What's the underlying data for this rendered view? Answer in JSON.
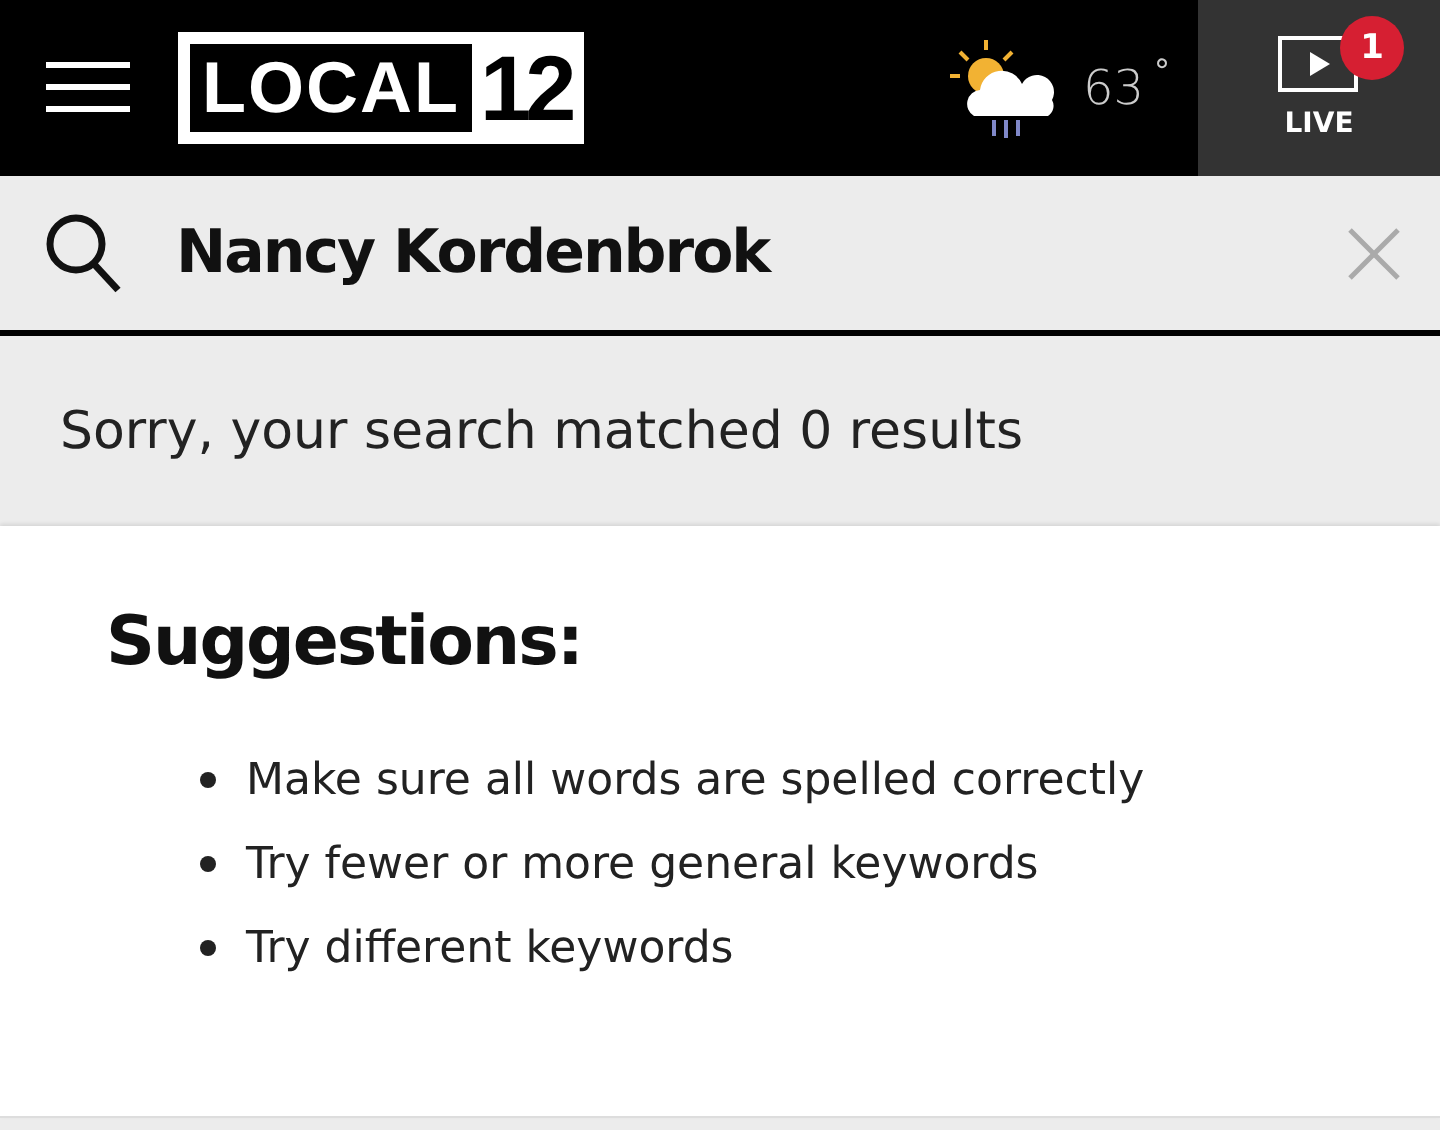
{
  "header": {
    "logo": {
      "word": "LOCAL",
      "number": "12"
    },
    "weather": {
      "temperature": "63",
      "unit": "°"
    },
    "live": {
      "label": "LIVE",
      "badge": "1"
    }
  },
  "search": {
    "value": "Nancy Kordenbrok"
  },
  "message": "Sorry, your search matched 0 results",
  "suggestions": {
    "title": "Suggestions:",
    "items": [
      "Make sure all words are spelled correctly",
      "Try fewer or more general keywords",
      "Try different keywords"
    ]
  }
}
